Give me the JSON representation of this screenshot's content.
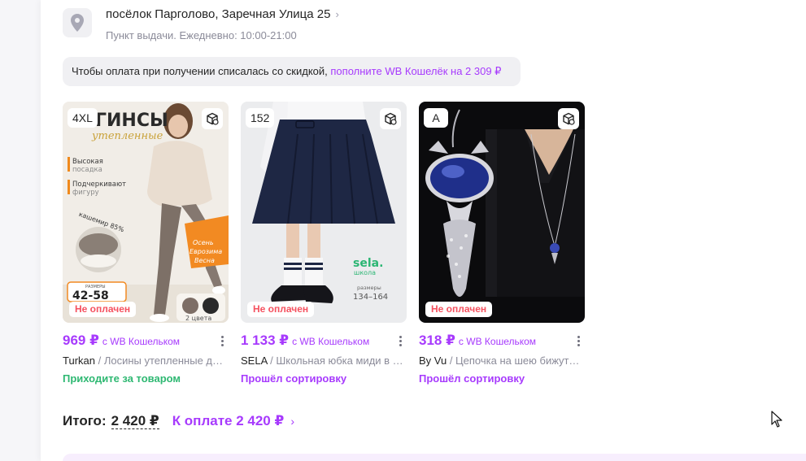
{
  "pickup": {
    "address": "посёлок Парголово, Заречная Улица 25",
    "subtitle": "Пункт выдачи. Ежедневно: 10:00-21:00",
    "icon": "location-pin-icon"
  },
  "banner": {
    "text": "Чтобы оплата при получении списалась со скидкой, ",
    "link": "пополните WB Кошелёк на 2 309 ₽"
  },
  "items": [
    {
      "size": "4XL",
      "badge": "Не оплачен",
      "price": "969 ₽",
      "price_suffix": "с WB Кошельком",
      "brand": "Turkan",
      "title": " / Лосины утепленные для женщин",
      "status": "Приходите за товаром",
      "status_color": "#2eb872",
      "poster": {
        "headline": "ГИНСЫ",
        "subhead": "утепленные",
        "bullet1": "Высокая посадка",
        "bullet2": "Подчеркивают фигуру",
        "cashmere": "кашемир 85%",
        "sizes_label": "РАЗМЕРЫ",
        "sizes": "42-58",
        "season": "Осень Евро­зима Весна",
        "colors": "2 цвета"
      }
    },
    {
      "size": "152",
      "badge": "Не оплачен",
      "price": "1 133 ₽",
      "price_suffix": "с WB Кошельком",
      "brand": "SELA",
      "title": " / Школьная юбка миди в складку",
      "status": "Прошёл сортировку",
      "status_color": "#a73afd",
      "poster": {
        "logo": "sela.",
        "logo_sub": "школа",
        "sizes_label": "размеры",
        "sizes": "134–164"
      }
    },
    {
      "size": "A",
      "badge": "Не оплачен",
      "price": "318 ₽",
      "price_suffix": "с WB Кошельком",
      "brand": "By Vu",
      "title": " / Цепочка на шею бижутерия",
      "status": "Прошёл сортировку",
      "status_color": "#a73afd"
    }
  ],
  "summary": {
    "total_label": "Итого:",
    "total_value": "2 420 ₽",
    "pay_label": "К оплате 2 420 ₽"
  },
  "colors": {
    "accent": "#a73afd",
    "unpaid": "#f5515f",
    "ready": "#2eb872"
  }
}
